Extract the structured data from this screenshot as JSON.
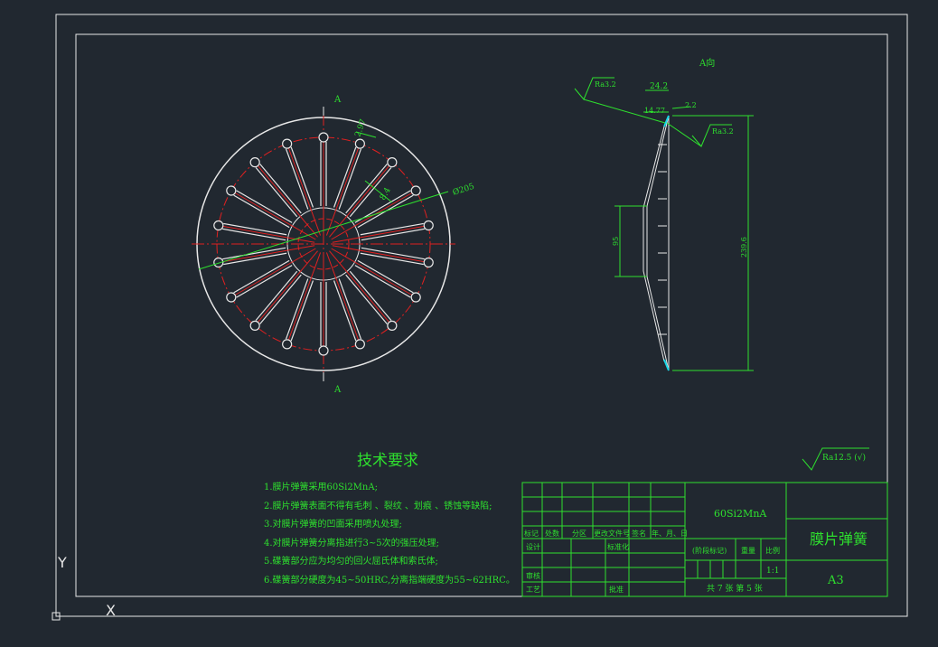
{
  "drawing": {
    "view_label": "A向",
    "axis_y": "Y",
    "axis_x": "X",
    "section_marks": [
      "A",
      "A"
    ],
    "front_view": {
      "dim_holes": "2.97",
      "dim_slot": "8.4",
      "dim_diameter": "Ø205"
    },
    "side_view": {
      "dim_top": "24.2",
      "dim_t1": "2.2",
      "dim_t2": "14.77",
      "dim_height": "239.6",
      "dim_inner": "95",
      "roughness_1": "Ra3.2",
      "roughness_2": "Ra3.2"
    },
    "roughness_global": "Ra12.5 (√)"
  },
  "tech": {
    "title": "技术要求",
    "items": [
      "1.膜片弹簧采用60Si2MnA;",
      "2.膜片弹簧表面不得有毛刺 、裂纹 、划痕 、锈蚀等缺陷;",
      "3.对膜片弹簧的凹面采用喷丸处理;",
      "4.对膜片弹簧分离指进行3~5次的强压处理;",
      "5.碟簧部分应为均匀的回火屈氏体和索氏体;",
      "6.碟簧部分硬度为45~50HRC,分离指端硬度为55~62HRC。"
    ]
  },
  "titleblock": {
    "material": "60Si2MnA",
    "part_name": "膜片弹簧",
    "size": "A3",
    "scale": "1:1",
    "sheet": "共 7 张 第 5 张",
    "labels": {
      "mark": "标记",
      "count": "处数",
      "zone": "分区",
      "docno": "更改文件号",
      "sign": "签名",
      "date": "年、月、日",
      "design": "设计",
      "standard": "标准化",
      "stage": "(阶段标记)",
      "weight": "重量",
      "ratio": "比例",
      "review": "审核",
      "process": "工艺",
      "approve": "批准"
    }
  }
}
